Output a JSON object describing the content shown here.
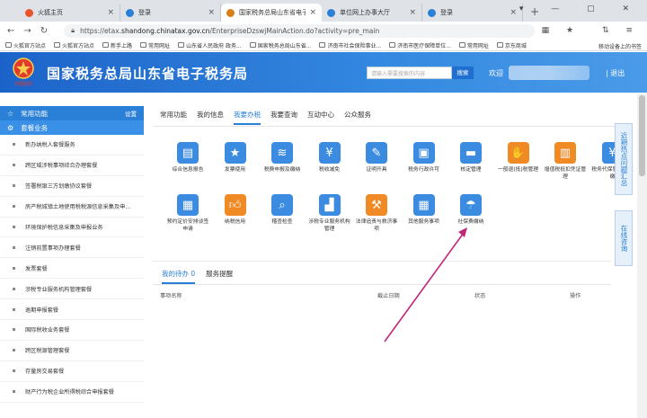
{
  "browser": {
    "tabs": [
      {
        "label": "火狐主页",
        "color": "#e8552d",
        "active": false
      },
      {
        "label": "登录",
        "color": "#2a7fd6",
        "active": false
      },
      {
        "label": "国家税务总局山东省电子税务局",
        "color": "#d9801a",
        "active": true
      },
      {
        "label": "单位网上办事大厅",
        "color": "#2a7fd6",
        "active": false
      },
      {
        "label": "登录",
        "color": "#2a7fd6",
        "active": false
      }
    ],
    "new_tab": "+",
    "url_prefix": "https://etax.",
    "url_host": "shandong.chinatax.gov.cn",
    "url_path": "/EnterpriseDzswjMainAction.do?activity=pre_main",
    "bookmarks": [
      "火狐官方站点",
      "火狐官方站点",
      "新手上路",
      "常用网址",
      "山东省人民政府 政务...",
      "国家税务总局山东省...",
      "济南市社会保险事业...",
      "济南市医疗保障单位...",
      "常用网址",
      "京东商城"
    ],
    "bookmarks_right": "移动设备上的书签"
  },
  "header": {
    "emblem_text": "中国税务",
    "title": "国家税务总局山东省电子税务局",
    "search_placeholder": "请输入需要搜索的内容",
    "search_button": "搜索",
    "welcome": "欢迎",
    "logout": "| 退出"
  },
  "sidebar": {
    "common_title": "常用功能",
    "settings": "设置",
    "sub_title": "套餐业务",
    "items": [
      "新办纳税人套餐服务",
      "跨区域涉税事项综合办理套餐",
      "签署税银三方划缴协议套餐",
      "房产税城镇土地使用税税源信息采集及申...",
      "环境保护税信息采集及申报业务",
      "注销前置事项办理套餐",
      "发票套餐",
      "涉税专业服务机构管理套餐",
      "逾期申报套餐",
      "国际税收业务套餐",
      "跨区税源管理套餐",
      "存量房交易套餐",
      "财产行为税企业所得税综合申报套餐"
    ]
  },
  "main": {
    "tabs": [
      "常用功能",
      "我的信息",
      "我要办税",
      "我要查询",
      "互动中心",
      "公众服务"
    ],
    "active_tab": 2,
    "tiles": [
      {
        "label": "综合信息报告",
        "color": "#3b8be0",
        "icon": "document-icon"
      },
      {
        "label": "发票使用",
        "color": "#3b8be0",
        "icon": "invoice-star-icon"
      },
      {
        "label": "税费申报及缴纳",
        "color": "#3b8be0",
        "icon": "layers-icon"
      },
      {
        "label": "税收减免",
        "color": "#3b8be0",
        "icon": "tax-relief-icon"
      },
      {
        "label": "证明开具",
        "color": "#3b8be0",
        "icon": "pen-icon"
      },
      {
        "label": "税务行政许可",
        "color": "#3b8be0",
        "icon": "license-icon"
      },
      {
        "label": "核定管理",
        "color": "#3b8be0",
        "icon": "folder-icon"
      },
      {
        "label": "一般退(抵)税管理",
        "color": "#f08a24",
        "icon": "refund-hand-icon"
      },
      {
        "label": "增值税抵扣凭证管理",
        "color": "#f08a24",
        "icon": "voucher-icon"
      },
      {
        "label": "税务代保管资金收缴",
        "color": "#3b8be0",
        "icon": "fund-icon"
      },
      {
        "label": "预约定价安排谈签申请",
        "color": "#3b8be0",
        "icon": "chart-doc-icon"
      },
      {
        "label": "纳税信用",
        "color": "#f08a24",
        "icon": "thumbs-up-icon"
      },
      {
        "label": "稽查检查",
        "color": "#3b8be0",
        "icon": "inspect-icon"
      },
      {
        "label": "涉税专业服务机构管理",
        "color": "#3b8be0",
        "icon": "building-icon"
      },
      {
        "label": "法律追责与救济事项",
        "color": "#f08a24",
        "icon": "gavel-icon"
      },
      {
        "label": "其他服务事项",
        "color": "#3b8be0",
        "icon": "grid-icon"
      },
      {
        "label": "社保费缴纳",
        "color": "#3b8be0",
        "icon": "social-security-icon"
      }
    ]
  },
  "float_panels": {
    "hotspot": "近期热点问题汇总",
    "consult": "在线咨询"
  },
  "todo": {
    "tabs": [
      "我的待办 0",
      "服务提醒"
    ],
    "columns": [
      "事项名称",
      "截止日期",
      "状态",
      "操作"
    ]
  },
  "annotation": {
    "arrow_color": "#c0267a"
  }
}
